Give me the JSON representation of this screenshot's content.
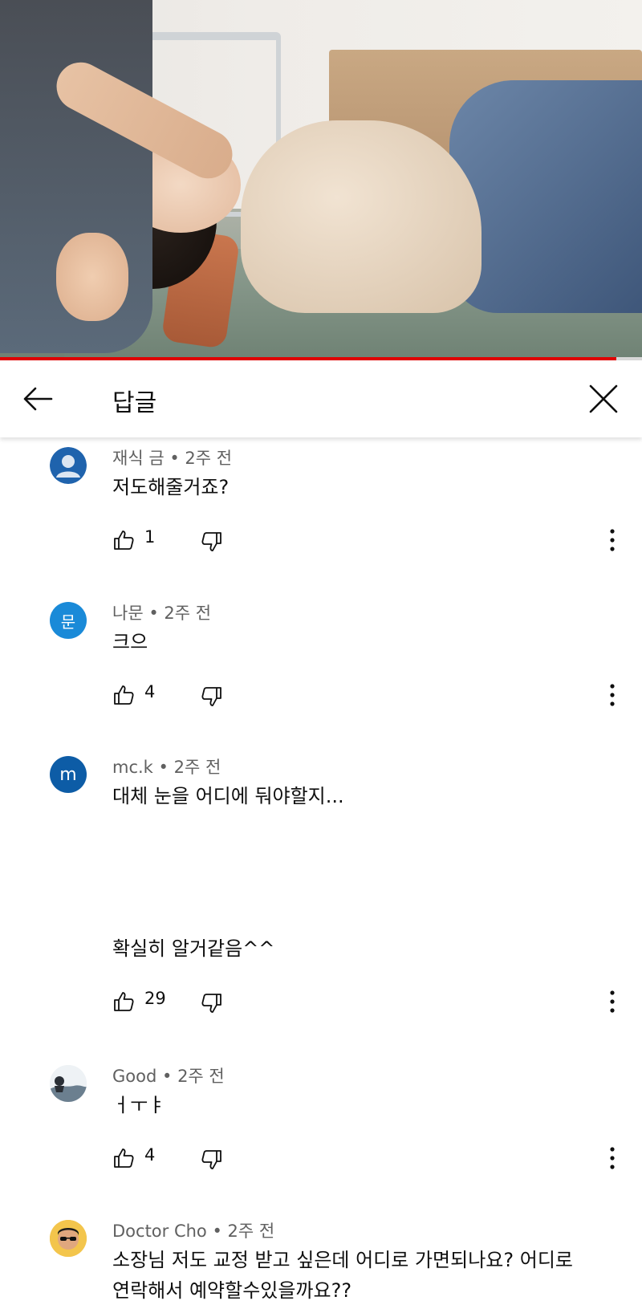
{
  "video": {
    "progress_fraction": 0.96
  },
  "header": {
    "title": "답글",
    "back_icon": "arrow-left-icon",
    "close_icon": "close-icon"
  },
  "comments": [
    {
      "author": "재식 금",
      "time": "2주 전",
      "text_lines": [
        "저도해줄거죠?"
      ],
      "likes": "1",
      "avatar_color": "#1f63ad",
      "avatar_type": "default-person"
    },
    {
      "author": "나문",
      "time": "2주 전",
      "text_lines": [
        "크으"
      ],
      "likes": "4",
      "avatar_color": "#1a8ad8",
      "avatar_letter": "문"
    },
    {
      "author": "mc.k",
      "time": "2주 전",
      "text_lines": [
        "대체 눈을 어디에 둬야할지...",
        "확실히 알거같음^^"
      ],
      "likes": "29",
      "avatar_color": "#0d5ca6",
      "avatar_letter": "m"
    },
    {
      "author": "Good",
      "time": "2주 전",
      "text_lines": [
        "ㅓㅜㅑ"
      ],
      "likes": "4",
      "avatar_type": "photo-landscape"
    },
    {
      "author": "Doctor Cho",
      "time": "2주 전",
      "text_lines": [
        "소장님 저도 교정 받고 싶은데 어디로 가면되나요? 어디로 연락해서 예약할수있을까요??"
      ],
      "likes": "",
      "avatar_type": "photo-person"
    }
  ],
  "separator": " • "
}
